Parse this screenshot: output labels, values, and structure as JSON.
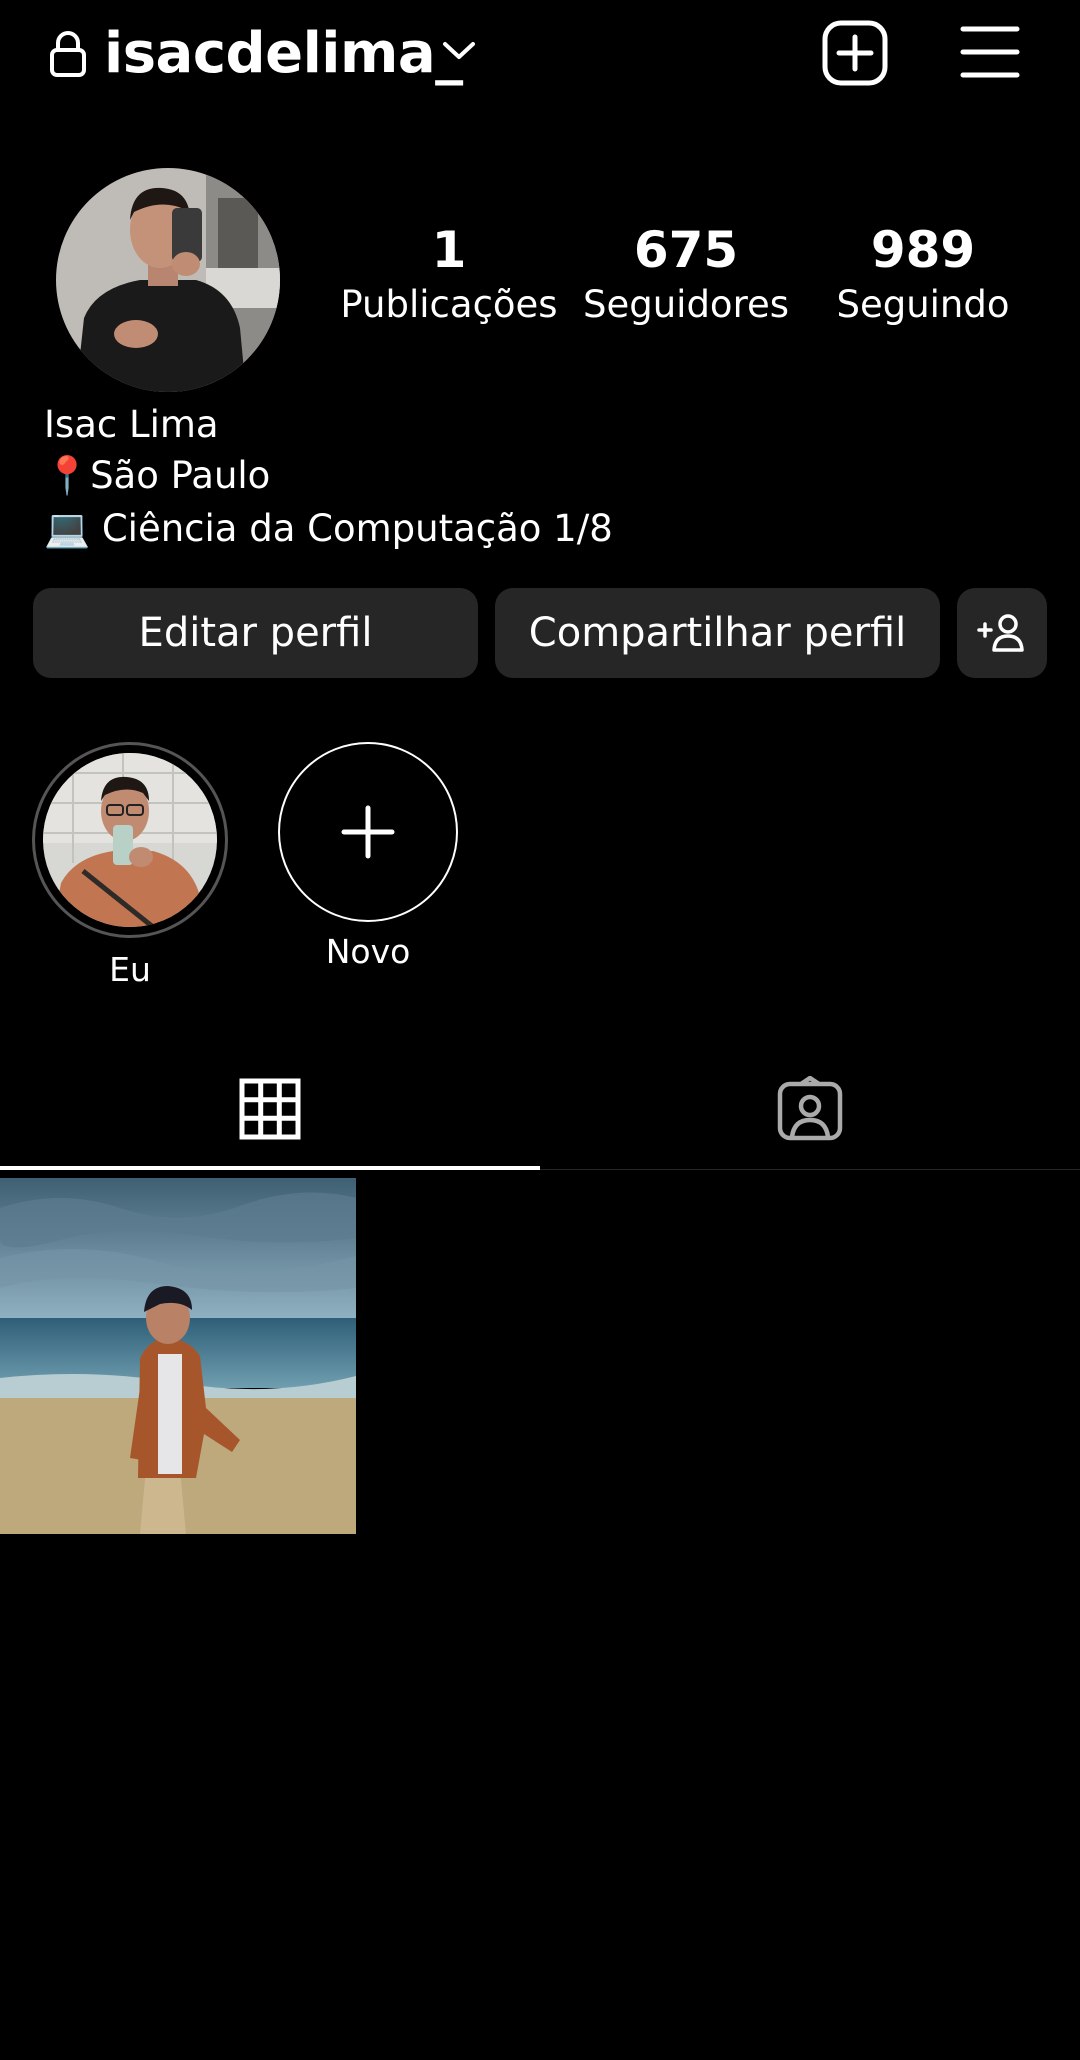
{
  "header": {
    "username": "isacdelima_",
    "lock_icon": "lock-icon",
    "dropdown_icon": "chevron-down-icon",
    "new_post_icon": "plus-square-icon",
    "menu_icon": "hamburger-menu-icon"
  },
  "profile": {
    "stats": [
      {
        "count": "1",
        "label": "Publicações"
      },
      {
        "count": "675",
        "label": "Seguidores"
      },
      {
        "count": "989",
        "label": "Seguindo"
      }
    ],
    "name": "Isac Lima",
    "bio": [
      "📍São Paulo",
      "💻 Ciência da Computação 1/8"
    ]
  },
  "buttons": {
    "edit": "Editar perfil",
    "share": "Compartilhar perfil",
    "discover_icon": "add-person-icon"
  },
  "highlights": [
    {
      "label": "Eu"
    },
    {
      "label": "Novo"
    }
  ],
  "tabs": {
    "grid_icon": "grid-icon",
    "tagged_icon": "tagged-person-icon"
  },
  "colors": {
    "background": "#000000",
    "button": "#262626",
    "text": "#ffffff"
  }
}
